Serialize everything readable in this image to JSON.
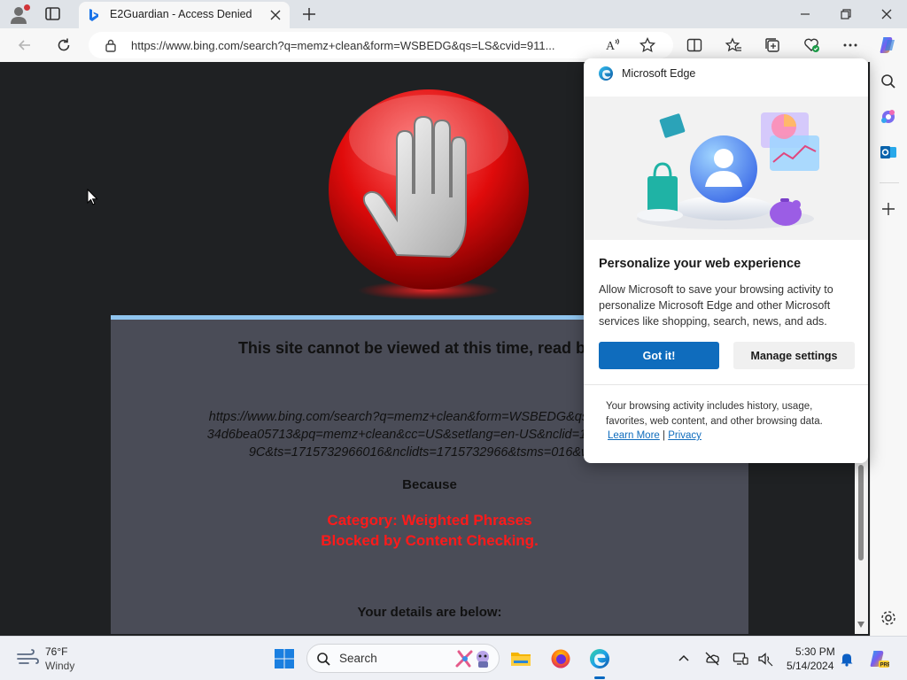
{
  "browser": {
    "tab_title": "E2Guardian - Access Denied",
    "url": "https://www.bing.com/search?q=memz+clean&form=WSBEDG&qs=LS&cvid=911..."
  },
  "page": {
    "heading": "This site cannot be viewed at this time, read below",
    "blocked_url_lines": [
      "https://www.bing.com/search?q=memz+clean&form=WSBEDG&qs=LS&cvid=",
      "34d6bea05713&pq=memz+clean&cc=US&setlang=en-US&nclid=12F4CDCA0",
      "9C&ts=1715732966016&nclidts=1715732966&tsms=016&wsso"
    ],
    "because_label": "Because",
    "reason_lines": [
      "Category: Weighted Phrases",
      "Blocked by Content Checking."
    ],
    "details_label": "Your details are below:"
  },
  "popup": {
    "header": "Microsoft Edge",
    "title": "Personalize your web experience",
    "body": "Allow Microsoft to save your browsing activity to personalize Microsoft Edge and other Microsoft services like shopping, search, news, and ads.",
    "primary_button": "Got it!",
    "secondary_button": "Manage settings",
    "footer": "Your browsing activity includes history, usage, favorites, web content, and other browsing data.",
    "learn_more": "Learn More",
    "separator": "|",
    "privacy": "Privacy"
  },
  "taskbar": {
    "weather_temp": "76°F",
    "weather_condition": "Windy",
    "search_label": "Search",
    "clock_time": "5:30 PM",
    "clock_date": "5/14/2024"
  },
  "colors": {
    "accent": "#0f6cbd",
    "page_background": "#1f2123",
    "panel_background": "#4a4c57",
    "reason_text": "#ff1a1a"
  },
  "icons": [
    "profile-icon",
    "tab-actions-icon",
    "bing-icon",
    "close-tab-icon",
    "new-tab-icon",
    "minimize-icon",
    "restore-icon",
    "window-close-icon",
    "back-icon",
    "refresh-icon",
    "lock-icon",
    "read-aloud-icon",
    "favorite-star-icon",
    "split-screen-icon",
    "favorites-icon",
    "collections-icon",
    "browser-essentials-icon",
    "more-icon",
    "copilot-icon",
    "search-icon",
    "copilot-sidebar-icon",
    "outlook-icon",
    "add-icon",
    "settings-icon",
    "stop-hand-icon",
    "edge-icon",
    "weather-icon",
    "windows-start-icon",
    "file-explorer-icon",
    "firefox-icon",
    "chevron-up-icon",
    "network-off-icon",
    "display-icon",
    "volume-icon",
    "notification-bell-icon",
    "copilot-taskbar-icon"
  ]
}
